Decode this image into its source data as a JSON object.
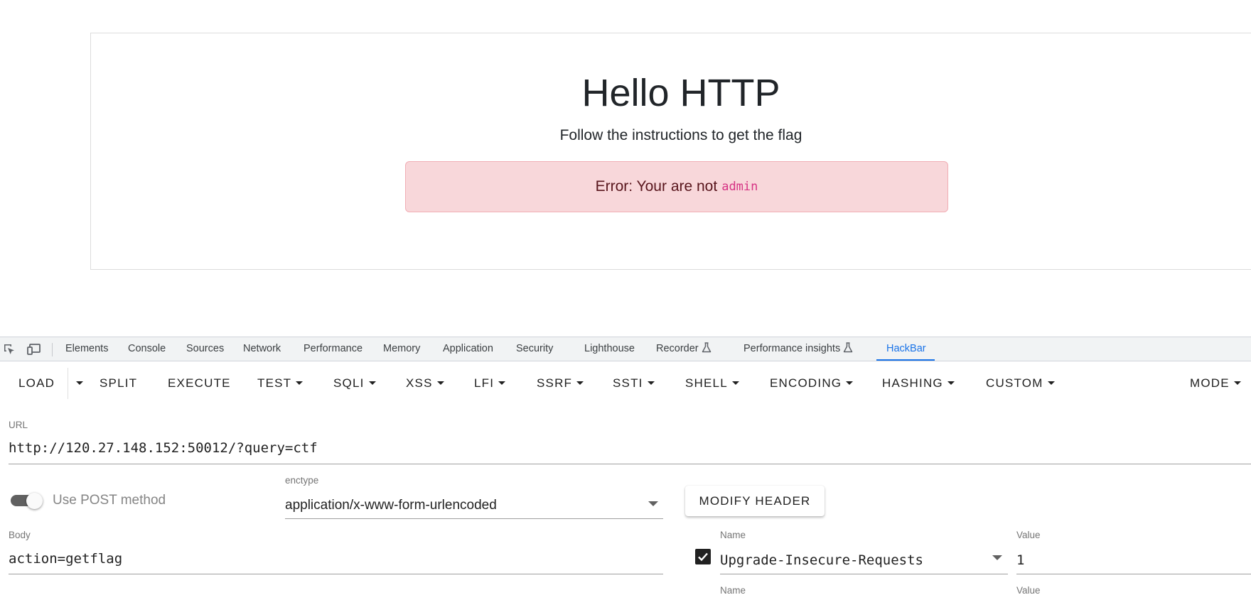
{
  "page": {
    "heading": "Hello HTTP",
    "subtitle": "Follow the instructions to get the flag",
    "alert": {
      "text": "Error: Your are not",
      "code": "admin"
    }
  },
  "devtools": {
    "tabs": [
      "Elements",
      "Console",
      "Sources",
      "Network",
      "Performance",
      "Memory",
      "Application",
      "Security",
      "Lighthouse",
      "Recorder",
      "Performance insights",
      "HackBar"
    ],
    "active_tab": "HackBar",
    "accent_color": "#1a73e8"
  },
  "hackbar": {
    "toolbar": [
      "LOAD",
      "SPLIT",
      "EXECUTE",
      "TEST",
      "SQLI",
      "XSS",
      "LFI",
      "SSRF",
      "SSTI",
      "SHELL",
      "ENCODING",
      "HASHING",
      "CUSTOM",
      "MODE"
    ],
    "url": {
      "label": "URL",
      "value": "http://120.27.148.152:50012/?query=ctf"
    },
    "post_toggle": {
      "label": "Use POST method",
      "enabled": true
    },
    "enctype": {
      "label": "enctype",
      "value": "application/x-www-form-urlencoded"
    },
    "modify_header_label": "MODIFY HEADER",
    "body": {
      "label": "Body",
      "value": "action=getflag"
    },
    "headers": [
      {
        "name_label": "Name",
        "value_label": "Value",
        "enabled": true,
        "name": "Upgrade-Insecure-Requests",
        "value": "1"
      },
      {
        "name_label": "Name",
        "value_label": "Value"
      }
    ]
  }
}
